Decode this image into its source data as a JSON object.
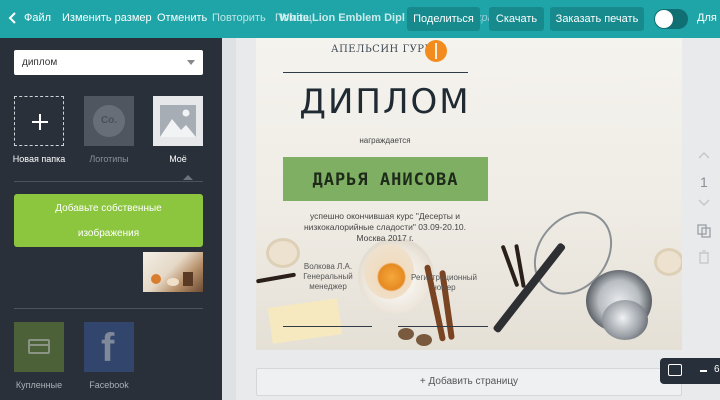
{
  "topbar": {
    "file": "Файл",
    "resize": "Изменить размер",
    "undo": "Отменить",
    "redo": "Повторить",
    "doc_title": "White Lion Emblem Dipl",
    "doc_title_tail": "охране",
    "hidden_text": "Помощ",
    "share": "Поделиться",
    "download": "Скачать",
    "order_print": "Заказать печать",
    "team_prefix": "Для"
  },
  "sidebar": {
    "search_value": "диплом",
    "tiles": [
      {
        "label": "Новая папка"
      },
      {
        "label": "Логотипы",
        "icon_text": "Co."
      },
      {
        "label": "Моё"
      }
    ],
    "upload_line1": "Добавьте собственные",
    "upload_line2": "изображения",
    "folders": [
      {
        "label": "Купленные"
      },
      {
        "label": "Facebook"
      }
    ]
  },
  "diploma": {
    "brand": "АПЕЛЬСИН ГУРМЭ",
    "title": "ДИПЛОМ",
    "awarded": "награждается",
    "recipient": "ДАРЬЯ АНИСОВА",
    "desc_line1": "успешно окончившая курс \"Десерты и",
    "desc_line2": "низкокалорийные сладости\" 03.09-20.10.",
    "desc_line3": "Москва 2017 г.",
    "sig_left_1": "Волкова Л.А.",
    "sig_left_2": "Генеральный",
    "sig_left_3": "менеджер",
    "sig_right_1": "Регистрационный",
    "sig_right_2": "номер"
  },
  "right_tools": {
    "page_number": "1"
  },
  "add_page": "+ Добавить страницу",
  "zoom_fragment": "6",
  "colors": {
    "topbar": "#1fa5a8",
    "sidebar": "#293039",
    "accent_green": "#8cc63f",
    "name_box": "#7faf63"
  }
}
